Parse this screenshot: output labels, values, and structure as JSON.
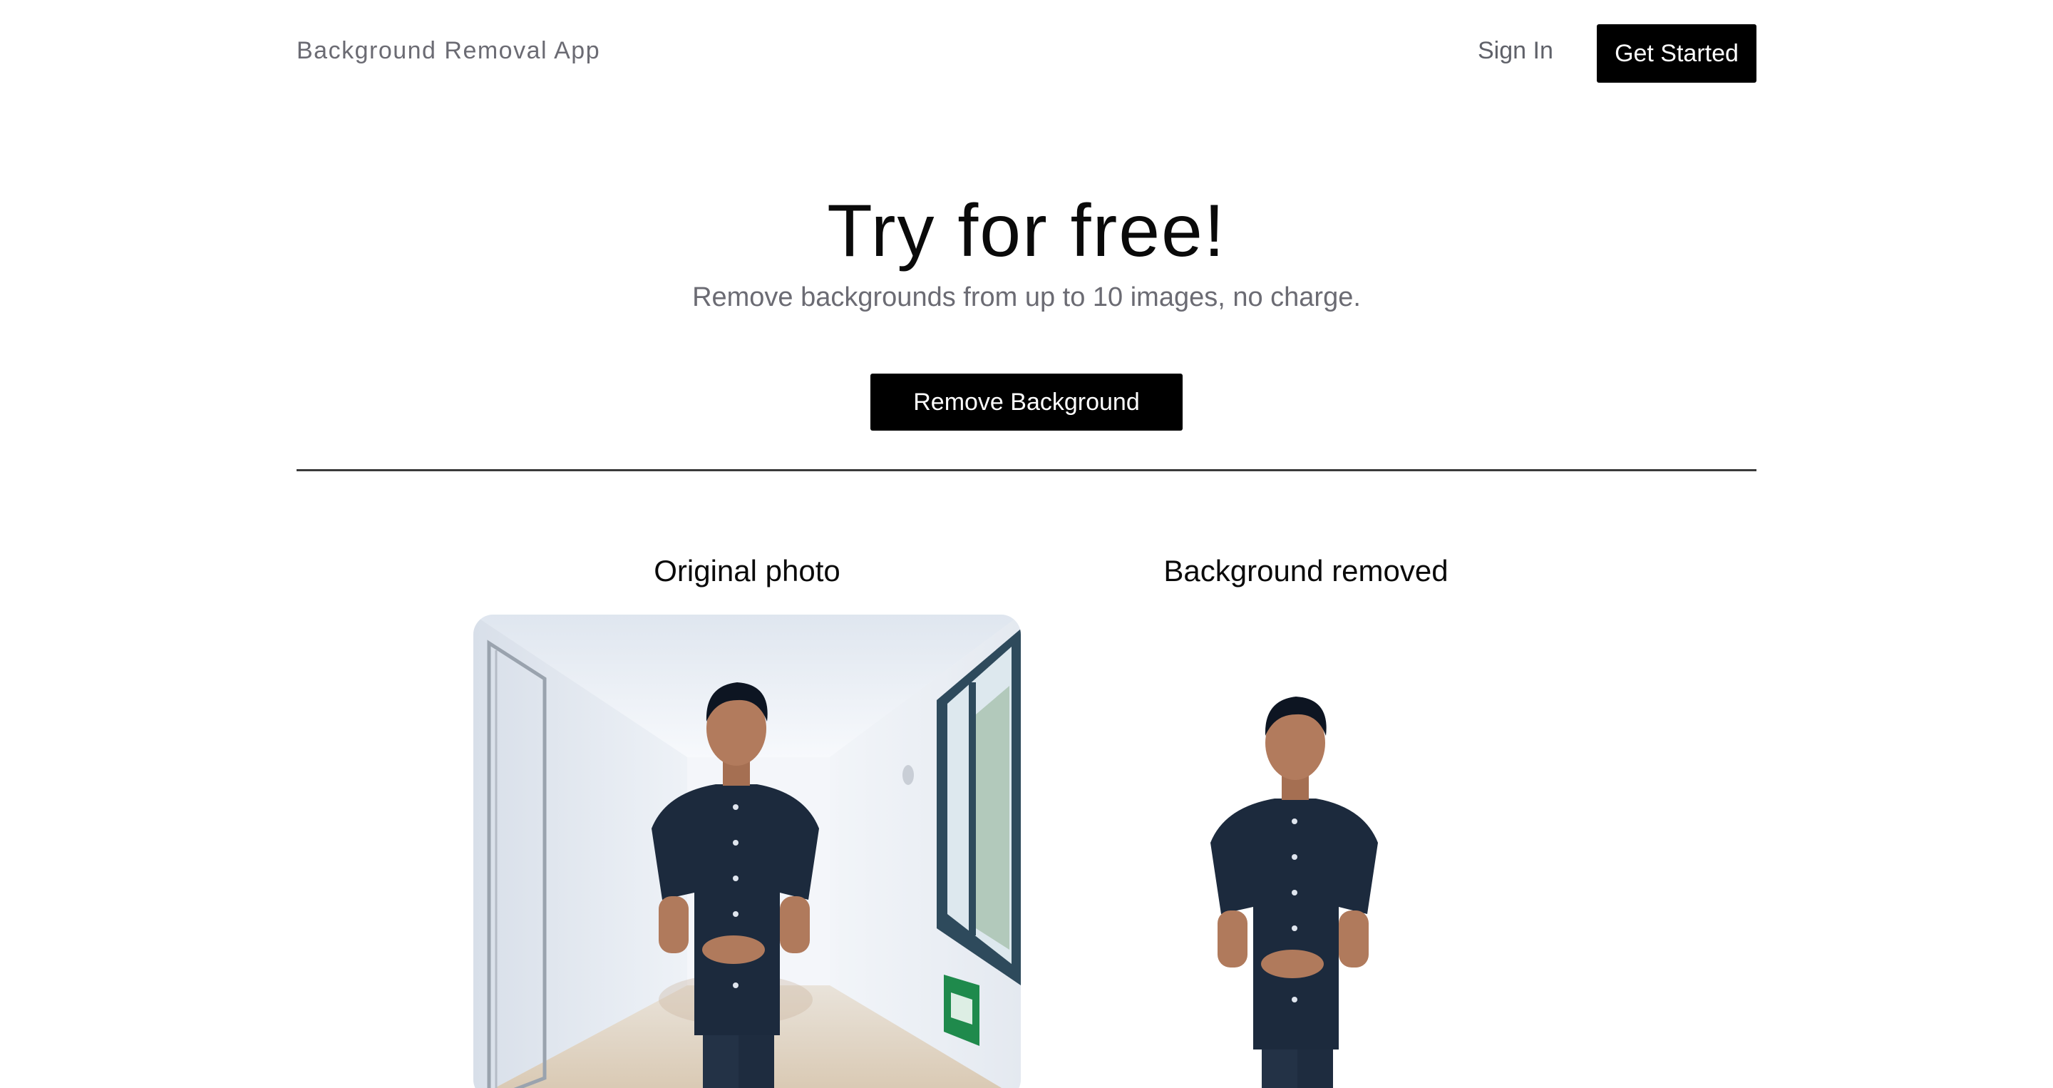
{
  "header": {
    "brand": "Background Removal App",
    "sign_in_label": "Sign In",
    "get_started_label": "Get Started"
  },
  "hero": {
    "title": "Try for free!",
    "subtitle": "Remove backgrounds from up to 10 images, no charge.",
    "cta_label": "Remove Background"
  },
  "comparison": {
    "original_label": "Original photo",
    "removed_label": "Background removed"
  },
  "colors": {
    "accent": "#000000",
    "muted_text": "#6b6b73",
    "background": "#ffffff"
  }
}
